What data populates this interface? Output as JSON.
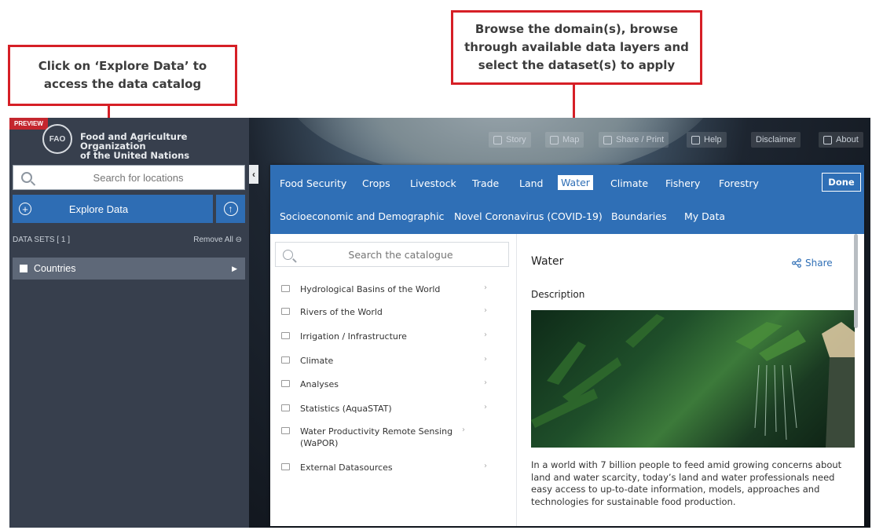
{
  "callouts": {
    "explore": "Click on ‘Explore Data’ to access the data catalog",
    "browse": "Browse the domain(s), browse through available data layers and select the dataset(s) to apply"
  },
  "topnav": [
    "Story",
    "Map",
    "Share / Print",
    "Help",
    "Disclaimer",
    "About"
  ],
  "sidebar": {
    "badge": "PREVIEW",
    "logo_text": "FAO",
    "org_line1": "Food and Agriculture Organization",
    "org_line2": "of the United Nations",
    "search_placeholder": "Search for locations",
    "explore_label": "Explore Data",
    "datasets_label": "DATA SETS  [ 1 ]",
    "remove_all": "Remove All ⊖",
    "dataset_item": "Countries"
  },
  "catalog": {
    "tabs_row1": [
      "Food Security",
      "Crops",
      "Livestock",
      "Trade",
      "Land",
      "Water",
      "Climate",
      "Fishery",
      "Forestry"
    ],
    "tabs_row2": [
      "Socioeconomic and Demographic",
      "Novel Coronavirus (COVID-19)",
      "Boundaries",
      "My Data"
    ],
    "active_tab": "Water",
    "done_label": "Done",
    "search_placeholder": "Search the catalogue",
    "items": [
      "Hydrological Basins of the World",
      "Rivers of the World",
      "Irrigation / Infrastructure",
      "Climate",
      "Analyses",
      "Statistics (AquaSTAT)",
      "Water Productivity Remote Sensing (WaPOR)",
      "External Datasources"
    ],
    "detail": {
      "title": "Water",
      "share_label": "Share",
      "description_label": "Description",
      "description_text": "In a world with 7 billion people to feed amid growing concerns about land and water scarcity, today’s land and water professionals need easy access to up-to-date information, models, approaches and technologies for sustainable food production."
    }
  },
  "colors": {
    "accent_blue": "#2f6fb6",
    "callout_red": "#d61f26",
    "sidebar_bg": "#373f4d"
  }
}
